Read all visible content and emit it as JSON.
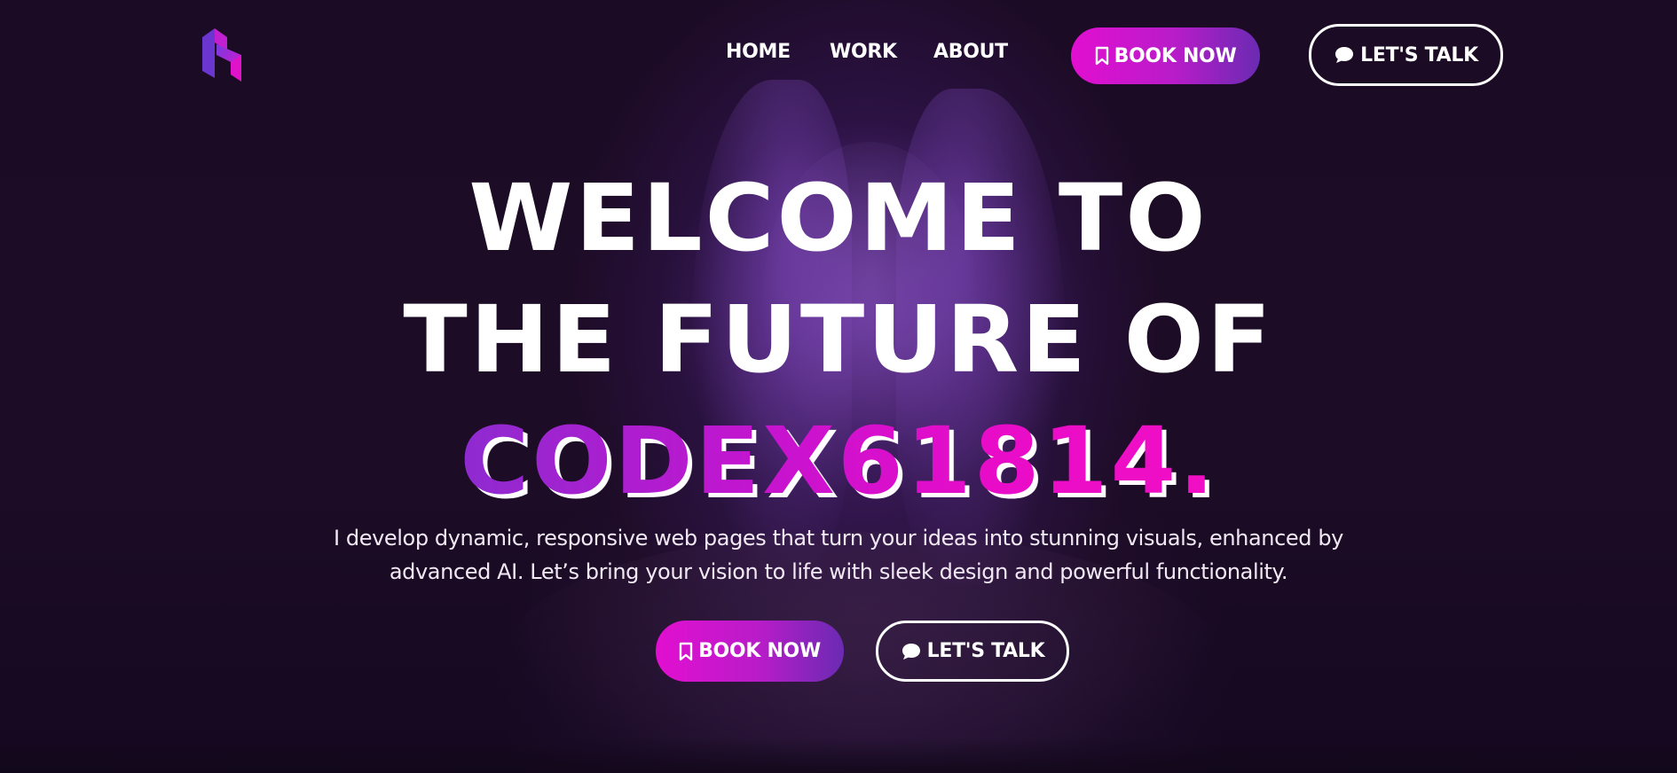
{
  "nav": {
    "logo": "brand-logo",
    "links": [
      {
        "label": "HOME"
      },
      {
        "label": "WORK"
      },
      {
        "label": "ABOUT"
      }
    ],
    "book_label": "BOOK NOW",
    "talk_label": "LET'S TALK"
  },
  "hero": {
    "headline_line1": "WELCOME TO",
    "headline_line2": "THE FUTURE OF",
    "headline_brand": "CODEX61814.",
    "subtitle_line1": "I develop dynamic, responsive web pages that turn your ideas into stunning visuals, enhanced by",
    "subtitle_line2": "advanced AI. Let’s bring your vision to life with sleek design and powerful functionality.",
    "book_label": "BOOK NOW",
    "talk_label": "LET'S TALK"
  },
  "icons": {
    "book": "bookmark-icon",
    "talk": "chat-bubble-icon"
  },
  "colors": {
    "background": "#1a0a22",
    "accent_pink": "#e20fd0",
    "accent_purple": "#6a2bb2",
    "text": "#ffffff"
  }
}
